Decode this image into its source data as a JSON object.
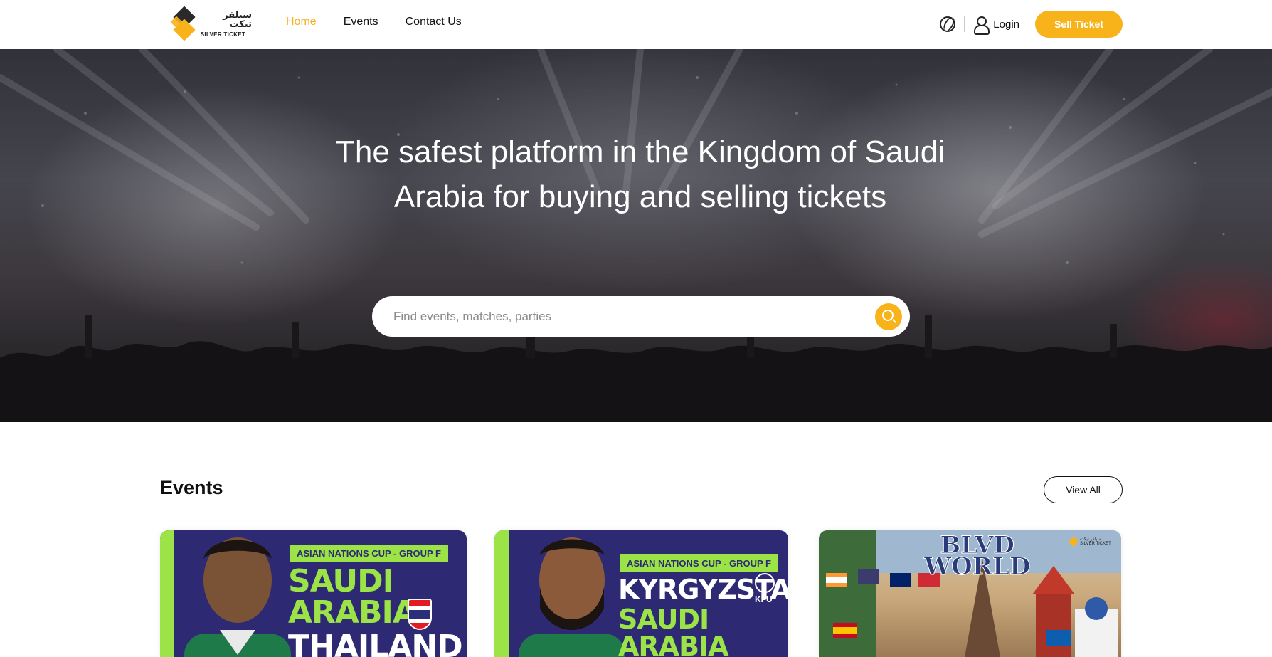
{
  "brand": {
    "name_ar": "سيلفر تيكت",
    "name_en": "SILVER TICKET",
    "accent": "#f8b31b"
  },
  "nav": {
    "items": [
      {
        "label": "Home",
        "active": true
      },
      {
        "label": "Events",
        "active": false
      },
      {
        "label": "Contact Us",
        "active": false
      }
    ],
    "language_icon": "globe-icon",
    "login_icon": "user-icon",
    "login_label": "Login",
    "sell_label": "Sell Ticket"
  },
  "hero": {
    "title": "The safest platform in the Kingdom of Saudi Arabia for buying and selling tickets",
    "search_placeholder": "Find events, matches, parties",
    "search_icon": "search-icon"
  },
  "events": {
    "title": "Events",
    "view_all_label": "View All",
    "cards": [
      {
        "badge": "ASIAN NATIONS CUP - GROUP F",
        "team1": "SAUDI ARABIA",
        "team2": "THAILAND"
      },
      {
        "badge": "ASIAN NATIONS CUP - GROUP F",
        "team1": "KYRGYZSTAN",
        "team2": "SAUDI ARABIA",
        "tag": "KFU"
      },
      {
        "title_line1": "BLVD",
        "title_line2": "WORLD",
        "mini_brand_ar": "سيلفر تيكت",
        "mini_brand_en": "SILVER TICKET"
      }
    ]
  }
}
